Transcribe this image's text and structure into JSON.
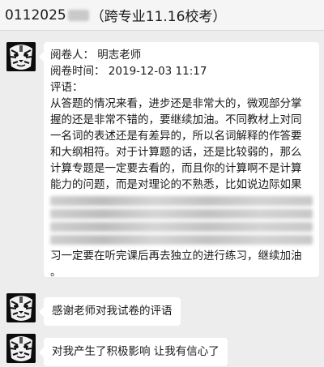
{
  "header": {
    "title_prefix": "0112025",
    "title_suffix": "（跨专业11.16校考）"
  },
  "messages": [
    {
      "avatar_icon": "tiger-face-icon",
      "reviewer_label": "阅卷人：",
      "reviewer_name": "明志老师",
      "time_label": "阅卷时间：",
      "time_value": "2019-12-03 11:17",
      "comment_label": "评语：",
      "comment_lines": [
        "从答题的情况来看，进步还是非常大的，微观部分掌",
        "握的还是非常不错的，要继续加油。不同教材上对同",
        "一名词的表述还是有差异的，所以名词解释的作答要",
        "和大纲相符。对于计算题的话，还是比较弱的，那么",
        "计算专题是一定要去看的，而且你的计算啊不是计算",
        "能力的问题，而是对理论的不熟悉，比如说边际如果"
      ],
      "comment_end_lines": [
        "习一定要在听完课后再去独立的进行练习，继续加油",
        "。"
      ]
    },
    {
      "avatar_icon": "tiger-face-icon",
      "text": "感谢老师对我试卷的评语"
    },
    {
      "avatar_icon": "tiger-face-icon",
      "text": "对我产生了积极影响 让我有信心了"
    }
  ]
}
